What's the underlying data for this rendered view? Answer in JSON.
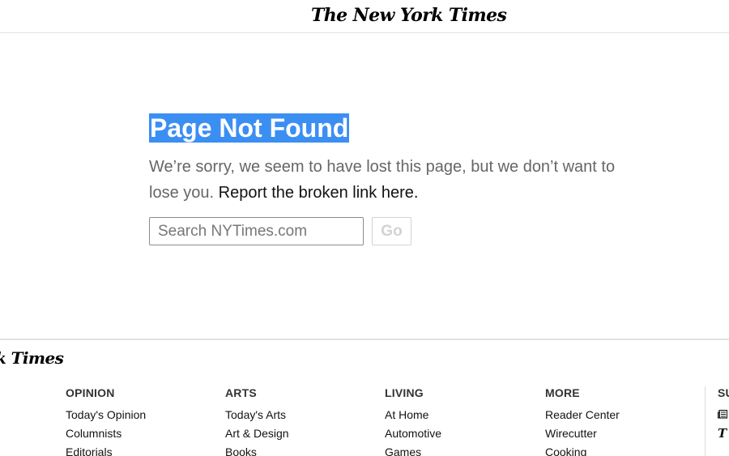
{
  "masthead": {
    "logo_text": "The New York Times"
  },
  "main": {
    "title": "Page Not Found",
    "message": "We’re sorry, we seem to have lost this page, but we don’t want to lose you.",
    "report_link": "Report the broken link here.",
    "search": {
      "placeholder": "Search NYTimes.com",
      "value": ""
    },
    "go_label": "Go"
  },
  "footer": {
    "logo_text": "k Times",
    "columns": [
      {
        "title": "OPINION",
        "items": [
          "Today's Opinion",
          "Columnists",
          "Editorials"
        ]
      },
      {
        "title": "ARTS",
        "items": [
          "Today's Arts",
          "Art & Design",
          "Books"
        ]
      },
      {
        "title": "LIVING",
        "items": [
          "At Home",
          "Automotive",
          "Games"
        ]
      },
      {
        "title": "MORE",
        "items": [
          "Reader Center",
          "Wirecutter",
          "Cooking"
        ]
      }
    ],
    "edge_column": {
      "title": "SU",
      "icons": [
        "newspaper-icon",
        "t-logo-icon"
      ]
    }
  }
}
